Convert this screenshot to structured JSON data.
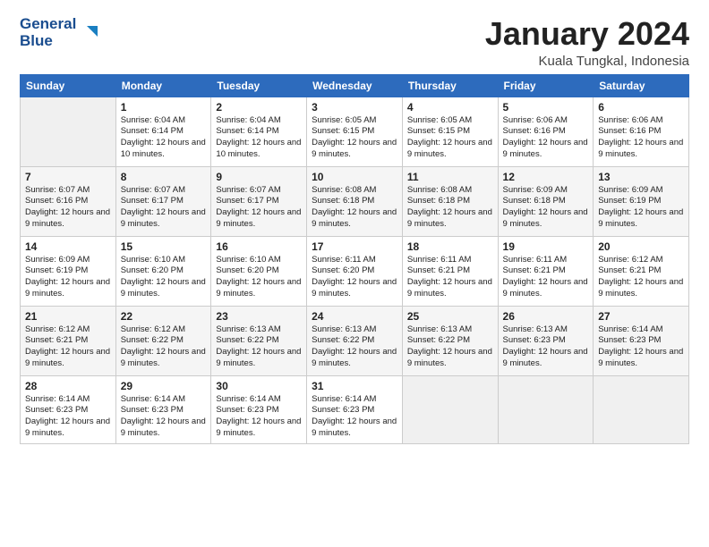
{
  "logo": {
    "line1": "General",
    "line2": "Blue"
  },
  "title": "January 2024",
  "subtitle": "Kuala Tungkal, Indonesia",
  "days_header": [
    "Sunday",
    "Monday",
    "Tuesday",
    "Wednesday",
    "Thursday",
    "Friday",
    "Saturday"
  ],
  "weeks": [
    [
      {
        "num": "",
        "sunrise": "",
        "sunset": "",
        "daylight": ""
      },
      {
        "num": "1",
        "sunrise": "Sunrise: 6:04 AM",
        "sunset": "Sunset: 6:14 PM",
        "daylight": "Daylight: 12 hours and 10 minutes."
      },
      {
        "num": "2",
        "sunrise": "Sunrise: 6:04 AM",
        "sunset": "Sunset: 6:14 PM",
        "daylight": "Daylight: 12 hours and 10 minutes."
      },
      {
        "num": "3",
        "sunrise": "Sunrise: 6:05 AM",
        "sunset": "Sunset: 6:15 PM",
        "daylight": "Daylight: 12 hours and 9 minutes."
      },
      {
        "num": "4",
        "sunrise": "Sunrise: 6:05 AM",
        "sunset": "Sunset: 6:15 PM",
        "daylight": "Daylight: 12 hours and 9 minutes."
      },
      {
        "num": "5",
        "sunrise": "Sunrise: 6:06 AM",
        "sunset": "Sunset: 6:16 PM",
        "daylight": "Daylight: 12 hours and 9 minutes."
      },
      {
        "num": "6",
        "sunrise": "Sunrise: 6:06 AM",
        "sunset": "Sunset: 6:16 PM",
        "daylight": "Daylight: 12 hours and 9 minutes."
      }
    ],
    [
      {
        "num": "7",
        "sunrise": "Sunrise: 6:07 AM",
        "sunset": "Sunset: 6:16 PM",
        "daylight": "Daylight: 12 hours and 9 minutes."
      },
      {
        "num": "8",
        "sunrise": "Sunrise: 6:07 AM",
        "sunset": "Sunset: 6:17 PM",
        "daylight": "Daylight: 12 hours and 9 minutes."
      },
      {
        "num": "9",
        "sunrise": "Sunrise: 6:07 AM",
        "sunset": "Sunset: 6:17 PM",
        "daylight": "Daylight: 12 hours and 9 minutes."
      },
      {
        "num": "10",
        "sunrise": "Sunrise: 6:08 AM",
        "sunset": "Sunset: 6:18 PM",
        "daylight": "Daylight: 12 hours and 9 minutes."
      },
      {
        "num": "11",
        "sunrise": "Sunrise: 6:08 AM",
        "sunset": "Sunset: 6:18 PM",
        "daylight": "Daylight: 12 hours and 9 minutes."
      },
      {
        "num": "12",
        "sunrise": "Sunrise: 6:09 AM",
        "sunset": "Sunset: 6:18 PM",
        "daylight": "Daylight: 12 hours and 9 minutes."
      },
      {
        "num": "13",
        "sunrise": "Sunrise: 6:09 AM",
        "sunset": "Sunset: 6:19 PM",
        "daylight": "Daylight: 12 hours and 9 minutes."
      }
    ],
    [
      {
        "num": "14",
        "sunrise": "Sunrise: 6:09 AM",
        "sunset": "Sunset: 6:19 PM",
        "daylight": "Daylight: 12 hours and 9 minutes."
      },
      {
        "num": "15",
        "sunrise": "Sunrise: 6:10 AM",
        "sunset": "Sunset: 6:20 PM",
        "daylight": "Daylight: 12 hours and 9 minutes."
      },
      {
        "num": "16",
        "sunrise": "Sunrise: 6:10 AM",
        "sunset": "Sunset: 6:20 PM",
        "daylight": "Daylight: 12 hours and 9 minutes."
      },
      {
        "num": "17",
        "sunrise": "Sunrise: 6:11 AM",
        "sunset": "Sunset: 6:20 PM",
        "daylight": "Daylight: 12 hours and 9 minutes."
      },
      {
        "num": "18",
        "sunrise": "Sunrise: 6:11 AM",
        "sunset": "Sunset: 6:21 PM",
        "daylight": "Daylight: 12 hours and 9 minutes."
      },
      {
        "num": "19",
        "sunrise": "Sunrise: 6:11 AM",
        "sunset": "Sunset: 6:21 PM",
        "daylight": "Daylight: 12 hours and 9 minutes."
      },
      {
        "num": "20",
        "sunrise": "Sunrise: 6:12 AM",
        "sunset": "Sunset: 6:21 PM",
        "daylight": "Daylight: 12 hours and 9 minutes."
      }
    ],
    [
      {
        "num": "21",
        "sunrise": "Sunrise: 6:12 AM",
        "sunset": "Sunset: 6:21 PM",
        "daylight": "Daylight: 12 hours and 9 minutes."
      },
      {
        "num": "22",
        "sunrise": "Sunrise: 6:12 AM",
        "sunset": "Sunset: 6:22 PM",
        "daylight": "Daylight: 12 hours and 9 minutes."
      },
      {
        "num": "23",
        "sunrise": "Sunrise: 6:13 AM",
        "sunset": "Sunset: 6:22 PM",
        "daylight": "Daylight: 12 hours and 9 minutes."
      },
      {
        "num": "24",
        "sunrise": "Sunrise: 6:13 AM",
        "sunset": "Sunset: 6:22 PM",
        "daylight": "Daylight: 12 hours and 9 minutes."
      },
      {
        "num": "25",
        "sunrise": "Sunrise: 6:13 AM",
        "sunset": "Sunset: 6:22 PM",
        "daylight": "Daylight: 12 hours and 9 minutes."
      },
      {
        "num": "26",
        "sunrise": "Sunrise: 6:13 AM",
        "sunset": "Sunset: 6:23 PM",
        "daylight": "Daylight: 12 hours and 9 minutes."
      },
      {
        "num": "27",
        "sunrise": "Sunrise: 6:14 AM",
        "sunset": "Sunset: 6:23 PM",
        "daylight": "Daylight: 12 hours and 9 minutes."
      }
    ],
    [
      {
        "num": "28",
        "sunrise": "Sunrise: 6:14 AM",
        "sunset": "Sunset: 6:23 PM",
        "daylight": "Daylight: 12 hours and 9 minutes."
      },
      {
        "num": "29",
        "sunrise": "Sunrise: 6:14 AM",
        "sunset": "Sunset: 6:23 PM",
        "daylight": "Daylight: 12 hours and 9 minutes."
      },
      {
        "num": "30",
        "sunrise": "Sunrise: 6:14 AM",
        "sunset": "Sunset: 6:23 PM",
        "daylight": "Daylight: 12 hours and 9 minutes."
      },
      {
        "num": "31",
        "sunrise": "Sunrise: 6:14 AM",
        "sunset": "Sunset: 6:23 PM",
        "daylight": "Daylight: 12 hours and 9 minutes."
      },
      {
        "num": "",
        "sunrise": "",
        "sunset": "",
        "daylight": ""
      },
      {
        "num": "",
        "sunrise": "",
        "sunset": "",
        "daylight": ""
      },
      {
        "num": "",
        "sunrise": "",
        "sunset": "",
        "daylight": ""
      }
    ]
  ]
}
